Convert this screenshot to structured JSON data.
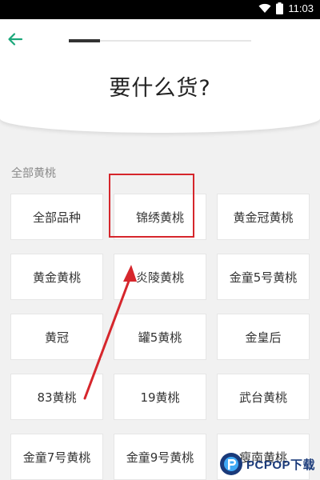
{
  "status_bar": {
    "time": "11:03"
  },
  "header": {
    "title": "要什么货?",
    "progress": 0.17
  },
  "section": {
    "label": "全部黄桃"
  },
  "grid": {
    "items": [
      "全部品种",
      "锦绣黄桃",
      "黄金冠黄桃",
      "黄金黄桃",
      "炎陵黄桃",
      "金童5号黄桃",
      "黄冠",
      "罐5黄桃",
      "金皇后",
      "83黄桃",
      "19黄桃",
      "武台黄桃",
      "金童7号黄桃",
      "金童9号黄桃",
      "瘦南黄桃"
    ]
  },
  "annotation": {
    "color": "#d6262c"
  },
  "watermark": {
    "text": "PCPOP下载",
    "color": "#1a3a7a"
  },
  "icons": {
    "back": "arrow-left-icon",
    "wifi": "wifi-icon",
    "battery": "battery-icon"
  },
  "colors": {
    "accent": "#1aa77a",
    "background": "#f1f1f1"
  }
}
